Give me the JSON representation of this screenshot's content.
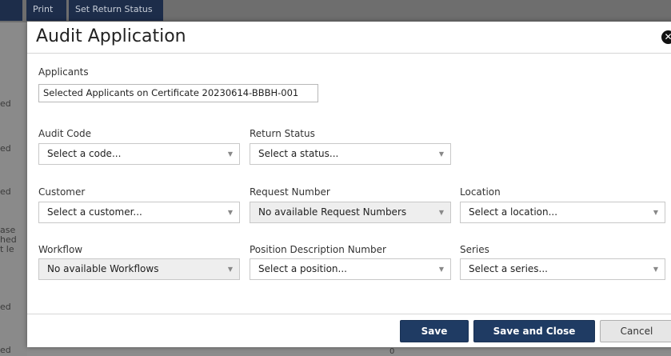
{
  "background": {
    "toolbar_buttons": [
      "Print",
      "Set Return Status"
    ],
    "left_fragments": [
      "ed",
      "ed",
      "ed",
      "ase",
      "hed",
      "t le",
      "ed",
      "ed"
    ],
    "bottom_fragment": "0"
  },
  "modal": {
    "title": "Audit Application",
    "close_label": "✕",
    "applicants": {
      "label": "Applicants",
      "value": "Selected Applicants on Certificate 20230614-BBBH-001"
    },
    "audit_code": {
      "label": "Audit Code",
      "value": "Select a code..."
    },
    "return_status": {
      "label": "Return Status",
      "value": "Select a status..."
    },
    "customer": {
      "label": "Customer",
      "value": "Select a customer..."
    },
    "request_number": {
      "label": "Request Number",
      "value": "No available Request Numbers"
    },
    "location": {
      "label": "Location",
      "value": "Select a location..."
    },
    "workflow": {
      "label": "Workflow",
      "value": "No available Workflows"
    },
    "position_description": {
      "label": "Position Description Number",
      "value": "Select a position..."
    },
    "series": {
      "label": "Series",
      "value": "Select a series..."
    },
    "buttons": {
      "save": "Save",
      "save_close": "Save and Close",
      "cancel": "Cancel"
    }
  },
  "colors": {
    "primary": "#1f3b63",
    "overlay": "#8c8c8c"
  }
}
